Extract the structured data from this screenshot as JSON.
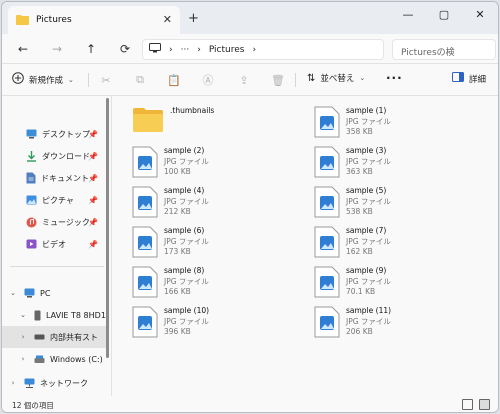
{
  "window": {
    "tab_title": "Pictures",
    "close_glyph": "✕",
    "new_tab_glyph": "+",
    "controls": [
      "—",
      "▢",
      "✕"
    ]
  },
  "address": {
    "back_glyph": "←",
    "forward_glyph": "→",
    "up_glyph": "↑",
    "refresh_glyph": "⟳",
    "path_sep": "›",
    "path_more": "···",
    "path_current": "Pictures",
    "search_placeholder": "Picturesの検"
  },
  "toolbar": {
    "new_label": "新規作成",
    "sort_label": "並べ替え",
    "more_label": "···",
    "detail_label": "詳細"
  },
  "sidebar": {
    "quick": [
      {
        "label": "デスクトップ",
        "icon": "desktop-icon",
        "color": "#3c8fd6"
      },
      {
        "label": "ダウンロード",
        "icon": "download-icon",
        "color": "#2f9a5a"
      },
      {
        "label": "ドキュメント",
        "icon": "document-icon",
        "color": "#4f7fc1"
      },
      {
        "label": "ピクチャ",
        "icon": "picture-icon",
        "color": "#3d8ee0"
      },
      {
        "label": "ミュージック",
        "icon": "music-icon",
        "color": "#e2574c"
      },
      {
        "label": "ビデオ",
        "icon": "video-icon",
        "color": "#8a52c8"
      }
    ],
    "tree": [
      {
        "label": "PC",
        "icon": "pc-icon",
        "chev": "⌄",
        "indent": 0
      },
      {
        "label": "LAVIE T8 8HD1",
        "icon": "tablet-icon",
        "chev": "⌄",
        "indent": 1
      },
      {
        "label": "内部共有スト",
        "icon": "storage-icon",
        "chev": "›",
        "indent": 2
      },
      {
        "label": "Windows (C:)",
        "icon": "drive-icon",
        "chev": "›",
        "indent": 1
      },
      {
        "label": "ネットワーク",
        "icon": "network-icon",
        "chev": "›",
        "indent": 0
      }
    ]
  },
  "files": [
    {
      "name": ".thumbnails",
      "type": "",
      "size": "",
      "kind": "folder"
    },
    {
      "name": "sample (1)",
      "type": "JPG ファイル",
      "size": "358 KB",
      "kind": "image"
    },
    {
      "name": "sample (2)",
      "type": "JPG ファイル",
      "size": "100 KB",
      "kind": "image"
    },
    {
      "name": "sample (3)",
      "type": "JPG ファイル",
      "size": "363 KB",
      "kind": "image"
    },
    {
      "name": "sample (4)",
      "type": "JPG ファイル",
      "size": "212 KB",
      "kind": "image"
    },
    {
      "name": "sample (5)",
      "type": "JPG ファイル",
      "size": "538 KB",
      "kind": "image"
    },
    {
      "name": "sample (6)",
      "type": "JPG ファイル",
      "size": "173 KB",
      "kind": "image"
    },
    {
      "name": "sample (7)",
      "type": "JPG ファイル",
      "size": "162 KB",
      "kind": "image"
    },
    {
      "name": "sample (8)",
      "type": "JPG ファイル",
      "size": "166 KB",
      "kind": "image"
    },
    {
      "name": "sample (9)",
      "type": "JPG ファイル",
      "size": "70.1 KB",
      "kind": "image"
    },
    {
      "name": "sample (10)",
      "type": "JPG ファイル",
      "size": "396 KB",
      "kind": "image"
    },
    {
      "name": "sample (11)",
      "type": "JPG ファイル",
      "size": "206 KB",
      "kind": "image"
    }
  ],
  "status": {
    "item_count": "12 個の項目"
  },
  "colors": {
    "folder": "#f5c745",
    "image_accent": "#2e7fd4",
    "selected_bg": "#e3e3e3"
  }
}
